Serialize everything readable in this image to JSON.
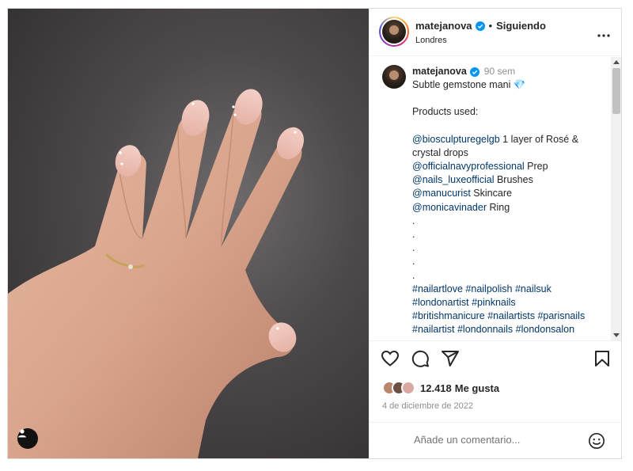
{
  "post": {
    "username": "matejanova",
    "follow_status": "Siguiendo",
    "location": "Londres",
    "more_icon": "more-horizontal-icon",
    "tag_icon": "user-tag-icon"
  },
  "caption": {
    "username": "matejanova",
    "time": "90 sem",
    "title": "Subtle gemstone mani 💎",
    "products_heading": "Products used:",
    "mention_1": "@biosculpturegelgb",
    "text_1": " 1 layer of Rosé & crystal drops",
    "mention_2": "@officialnavyprofessional",
    "text_2": " Prep",
    "mention_3": "@nails_luxeofficial",
    "text_3": " Brushes",
    "mention_4": "@manucurist",
    "text_4": " Skincare",
    "mention_5": "@monicavinader",
    "text_5": " Ring",
    "dots": [
      ".",
      ".",
      ".",
      ".",
      "."
    ],
    "hashtags": [
      [
        "#nailartlove",
        "#nailpolish",
        "#nailsuk"
      ],
      [
        "#londonartist",
        "#pinknails"
      ],
      [
        "#britishmanicure",
        "#nailartists",
        "#parisnails"
      ],
      [
        "#nailartist",
        "#londonnails",
        "#londonsalon"
      ]
    ]
  },
  "actions": {
    "like_icon": "heart-icon",
    "comment_icon": "comment-icon",
    "share_icon": "send-icon",
    "save_icon": "bookmark-icon",
    "likes_count": "12.418",
    "likes_label": "Me gusta",
    "date": "4 de diciembre de 2022"
  },
  "comment": {
    "placeholder": "Añade un comentario...",
    "emoji_icon": "emoji-icon"
  },
  "colors": {
    "link": "#00376b",
    "verified": "#0095f6",
    "muted": "#8e8e8e"
  }
}
